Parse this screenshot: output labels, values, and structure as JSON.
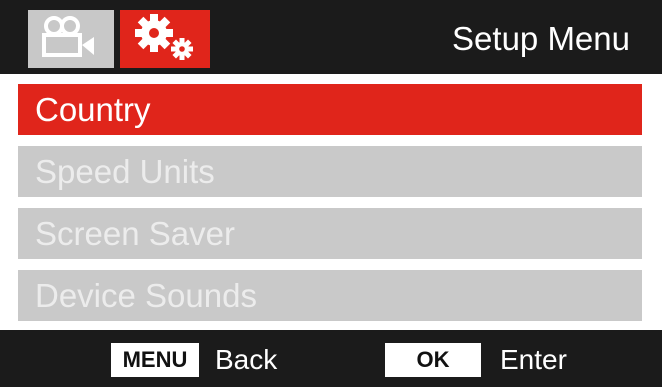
{
  "colors": {
    "accent_red": "#e0251b",
    "bar_dark": "#1b1b1b",
    "item_grey": "#c9c9c9"
  },
  "tabs": [
    {
      "icon": "video-camera-icon",
      "active": false
    },
    {
      "icon": "gears-icon",
      "active": true
    }
  ],
  "header": {
    "title": "Setup Menu"
  },
  "menu": {
    "selected_index": 0,
    "items": [
      {
        "label": "Country"
      },
      {
        "label": "Speed Units"
      },
      {
        "label": "Screen Saver"
      },
      {
        "label": "Device Sounds"
      }
    ]
  },
  "footer": {
    "menu_key": "MENU",
    "menu_action": "Back",
    "ok_key": "OK",
    "ok_action": "Enter"
  }
}
